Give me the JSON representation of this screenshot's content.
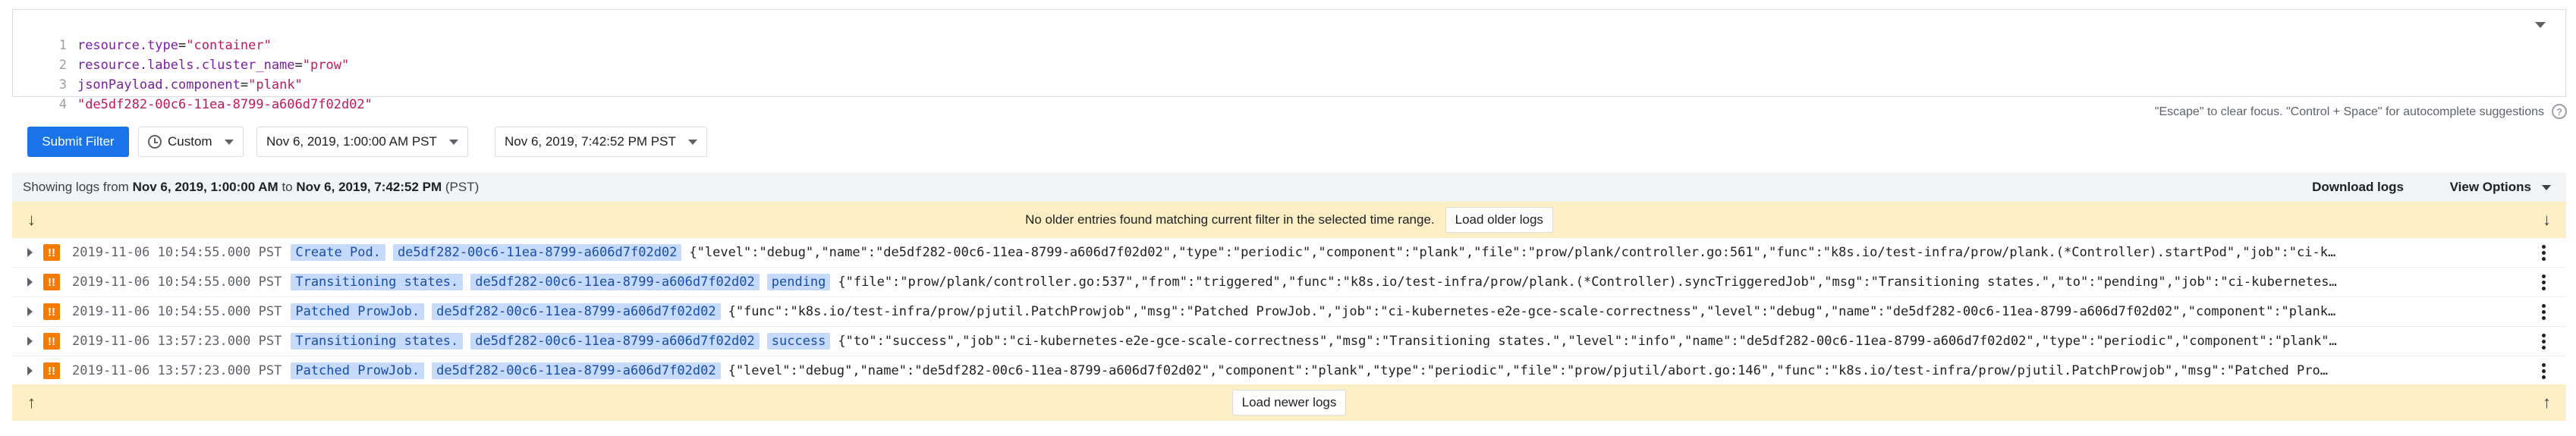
{
  "editor": {
    "lines": [
      {
        "num": "1",
        "key": "resource.type",
        "op": "=",
        "value": "\"container\""
      },
      {
        "num": "2",
        "key": "resource.labels.cluster_name",
        "op": "=",
        "value": "\"prow\""
      },
      {
        "num": "3",
        "key": "jsonPayload.component",
        "op": "=",
        "value": "\"plank\""
      },
      {
        "num": "4",
        "key": "",
        "op": "",
        "value": "\"de5df282-00c6-11ea-8799-a606d7f02d02\""
      }
    ]
  },
  "controls": {
    "submit_label": "Submit Filter",
    "range_label": "Custom",
    "start_date": "Nov 6, 2019, 1:00:00 AM PST",
    "end_date": "Nov 6, 2019, 7:42:52 PM PST",
    "hint": "\"Escape\" to clear focus. \"Control + Space\" for autocomplete suggestions",
    "help_glyph": "?"
  },
  "results": {
    "showing_prefix": "Showing logs from ",
    "from": "Nov 6, 2019, 1:00:00 AM",
    "to_word": " to ",
    "to": "Nov 6, 2019, 7:42:52 PM",
    "suffix": " (PST)",
    "download_label": "Download logs",
    "view_options_label": "View Options"
  },
  "top_notice": {
    "message": "No older entries found matching current filter in the selected time range.",
    "button_label": "Load older logs",
    "arrow": "↓"
  },
  "bottom_notice": {
    "button_label": "Load newer logs",
    "arrow": "↑"
  },
  "logs": [
    {
      "severity": "!!",
      "timestamp": "2019-11-06 10:54:55.000 PST",
      "chips": [
        "Create Pod.",
        "de5df282-00c6-11ea-8799-a606d7f02d02"
      ],
      "payload": "{\"level\":\"debug\",\"name\":\"de5df282-00c6-11ea-8799-a606d7f02d02\",\"type\":\"periodic\",\"component\":\"plank\",\"file\":\"prow/plank/controller.go:561\",\"func\":\"k8s.io/test-infra/prow/plank.(*Controller).startPod\",\"job\":\"ci-k…"
    },
    {
      "severity": "!!",
      "timestamp": "2019-11-06 10:54:55.000 PST",
      "chips": [
        "Transitioning states.",
        "de5df282-00c6-11ea-8799-a606d7f02d02",
        "pending"
      ],
      "payload": "{\"file\":\"prow/plank/controller.go:537\",\"from\":\"triggered\",\"func\":\"k8s.io/test-infra/prow/plank.(*Controller).syncTriggeredJob\",\"msg\":\"Transitioning states.\",\"to\":\"pending\",\"job\":\"ci-kubernetes…"
    },
    {
      "severity": "!!",
      "timestamp": "2019-11-06 10:54:55.000 PST",
      "chips": [
        "Patched ProwJob.",
        "de5df282-00c6-11ea-8799-a606d7f02d02"
      ],
      "payload": "{\"func\":\"k8s.io/test-infra/prow/pjutil.PatchProwjob\",\"msg\":\"Patched ProwJob.\",\"job\":\"ci-kubernetes-e2e-gce-scale-correctness\",\"level\":\"debug\",\"name\":\"de5df282-00c6-11ea-8799-a606d7f02d02\",\"component\":\"plank…"
    },
    {
      "severity": "!!",
      "timestamp": "2019-11-06 13:57:23.000 PST",
      "chips": [
        "Transitioning states.",
        "de5df282-00c6-11ea-8799-a606d7f02d02",
        "success"
      ],
      "payload": "{\"to\":\"success\",\"job\":\"ci-kubernetes-e2e-gce-scale-correctness\",\"msg\":\"Transitioning states.\",\"level\":\"info\",\"name\":\"de5df282-00c6-11ea-8799-a606d7f02d02\",\"type\":\"periodic\",\"component\":\"plank\"…"
    },
    {
      "severity": "!!",
      "timestamp": "2019-11-06 13:57:23.000 PST",
      "chips": [
        "Patched ProwJob.",
        "de5df282-00c6-11ea-8799-a606d7f02d02"
      ],
      "payload": "{\"level\":\"debug\",\"name\":\"de5df282-00c6-11ea-8799-a606d7f02d02\",\"component\":\"plank\",\"type\":\"periodic\",\"file\":\"prow/pjutil/abort.go:146\",\"func\":\"k8s.io/test-infra/prow/pjutil.PatchProwjob\",\"msg\":\"Patched Pro…"
    }
  ],
  "colors": {
    "primary": "#1a73e8",
    "notice_bg": "#fcefc6",
    "severity_warning": "#f57c00",
    "chip_bg": "#c6dafc"
  }
}
